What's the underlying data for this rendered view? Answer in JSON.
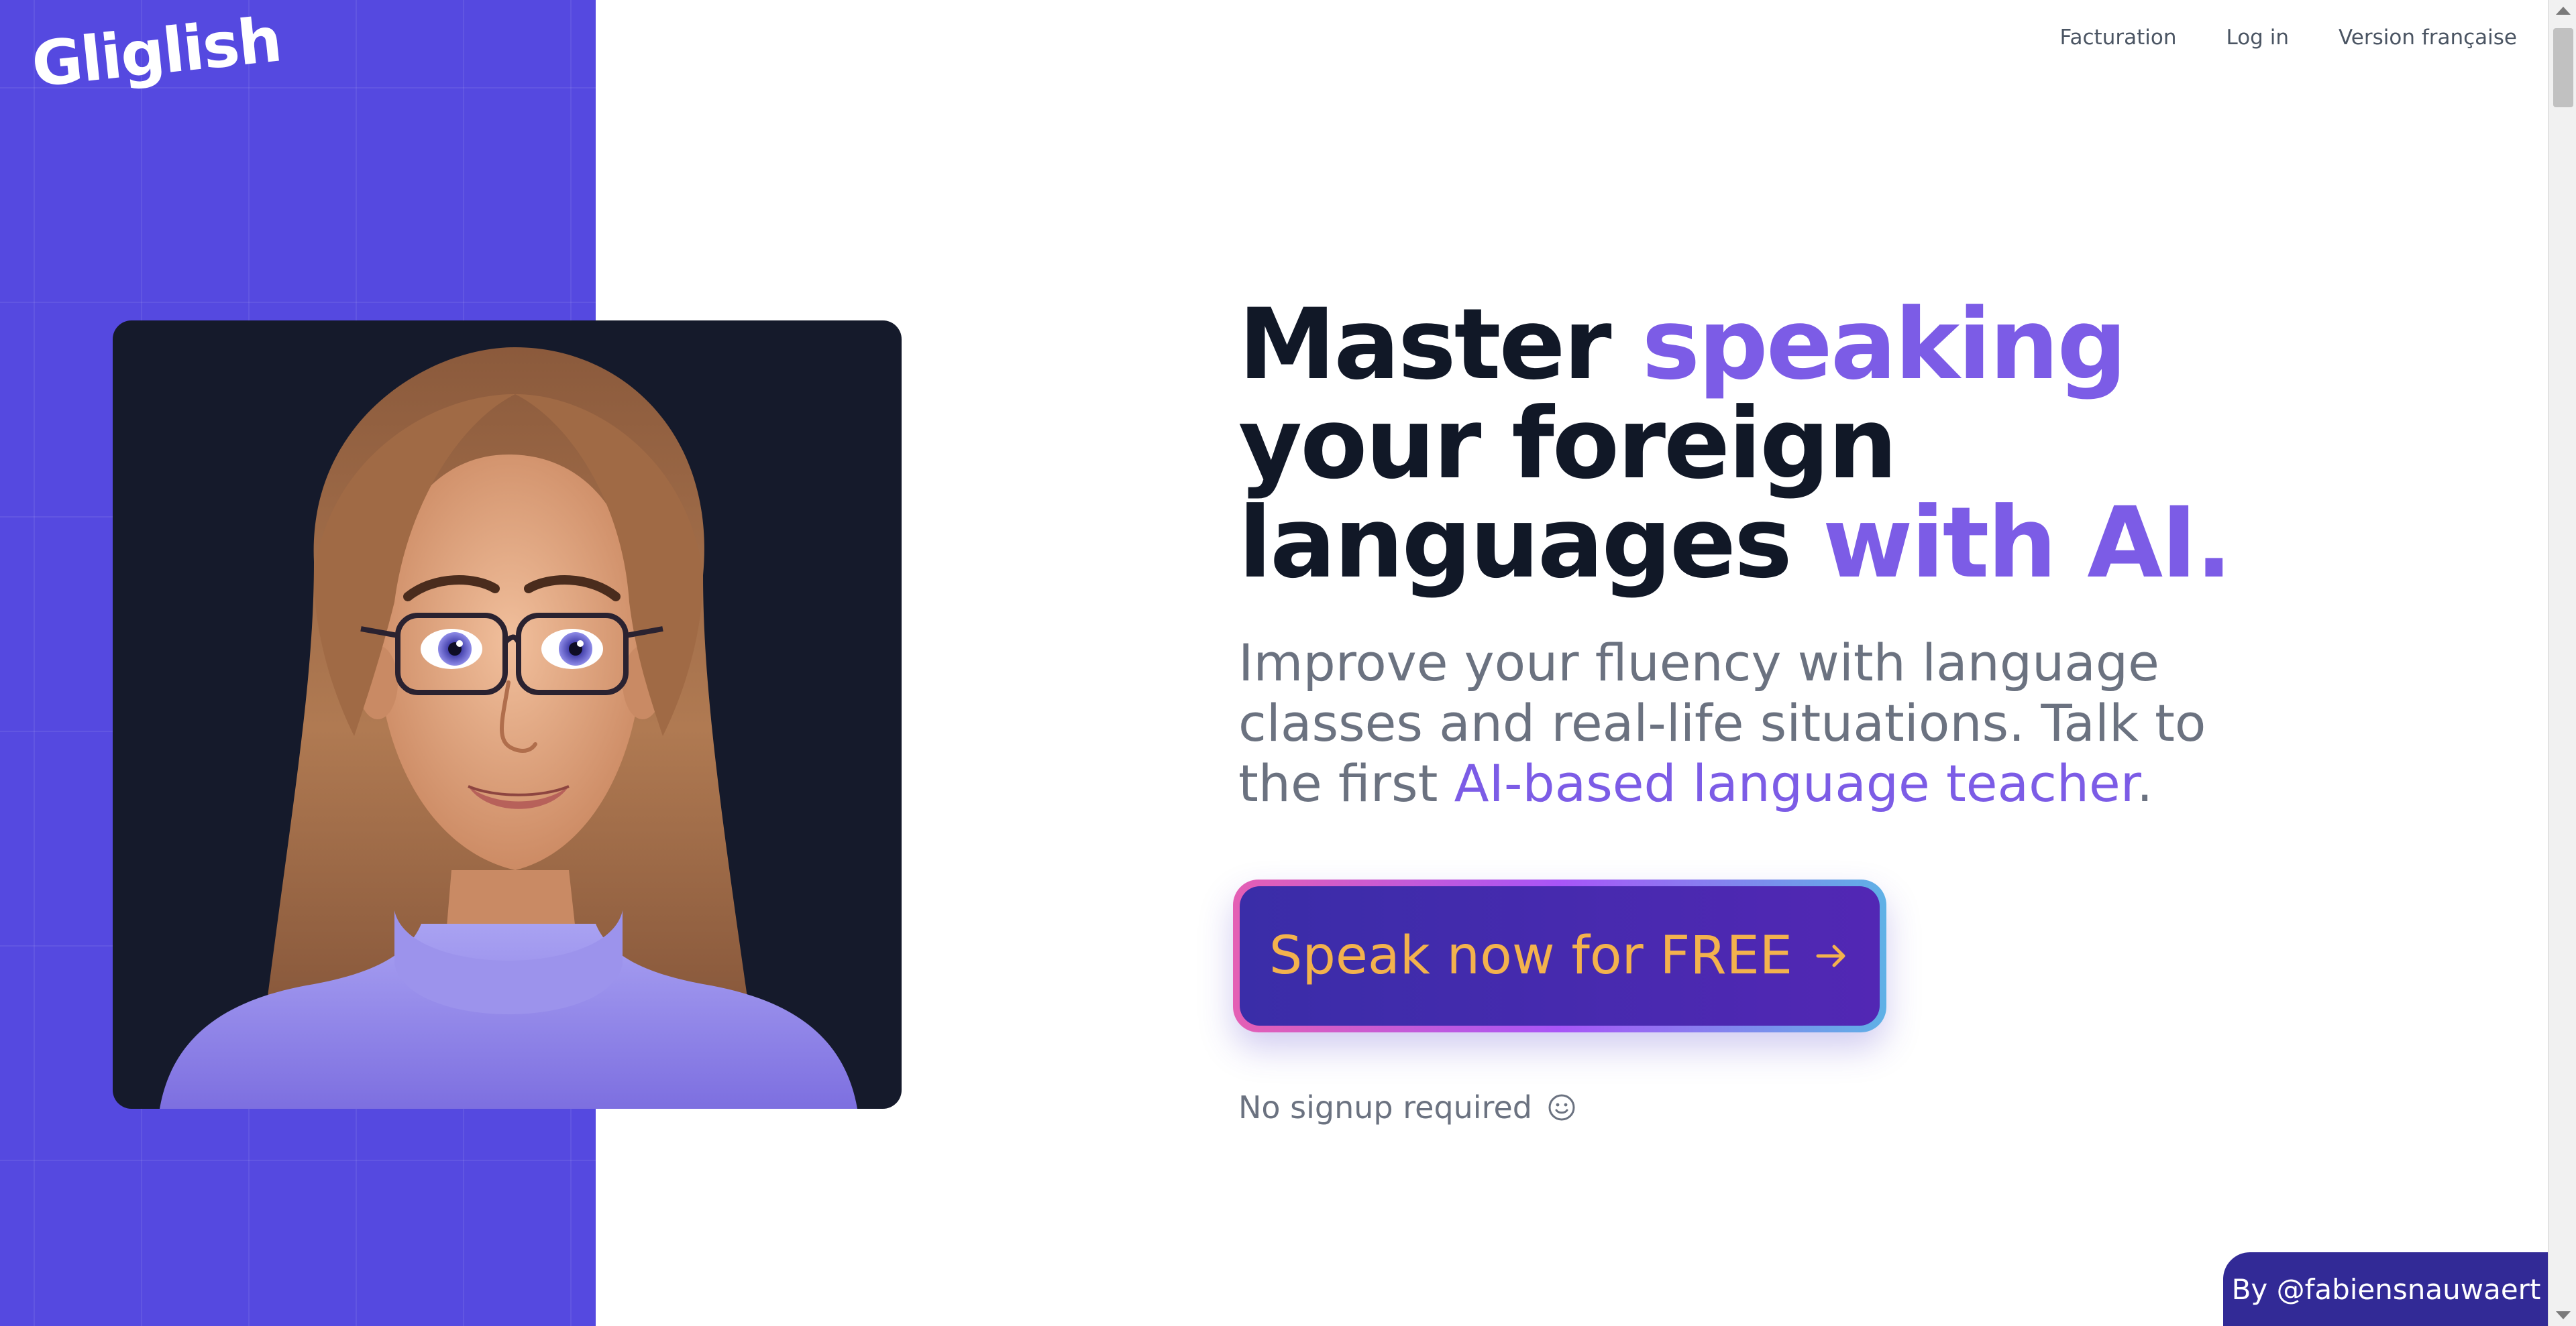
{
  "brand": {
    "logo_text": "Gliglish",
    "panel_color": "#5549e0"
  },
  "nav": {
    "items": [
      {
        "label": "Facturation"
      },
      {
        "label": "Log in"
      },
      {
        "label": "Version française"
      }
    ]
  },
  "hero": {
    "headline": {
      "part1": "Master ",
      "part2_accent": "speaking",
      "part3": "your foreign",
      "part4": "languages ",
      "part5_accent": "with AI."
    },
    "subtitle": {
      "part1": "Improve your fluency with language classes and real-life situations. Talk to the first ",
      "accent": "AI-based language teacher",
      "part2": "."
    },
    "cta": {
      "label": "Speak now for FREE",
      "icon": "arrow-right-icon"
    },
    "note": {
      "label": "No signup required",
      "icon": "smile-icon"
    },
    "portrait": {
      "description_icon": "ai-teacher-avatar"
    }
  },
  "footer": {
    "credit": "By @fabiensnauwaert"
  },
  "colors": {
    "accent": "#7c5ce6",
    "headline": "#111827",
    "body_text": "#6b7280",
    "cta_text": "#f3b24d",
    "cta_bg": "#4429b0",
    "credit_bg": "#322a96"
  }
}
